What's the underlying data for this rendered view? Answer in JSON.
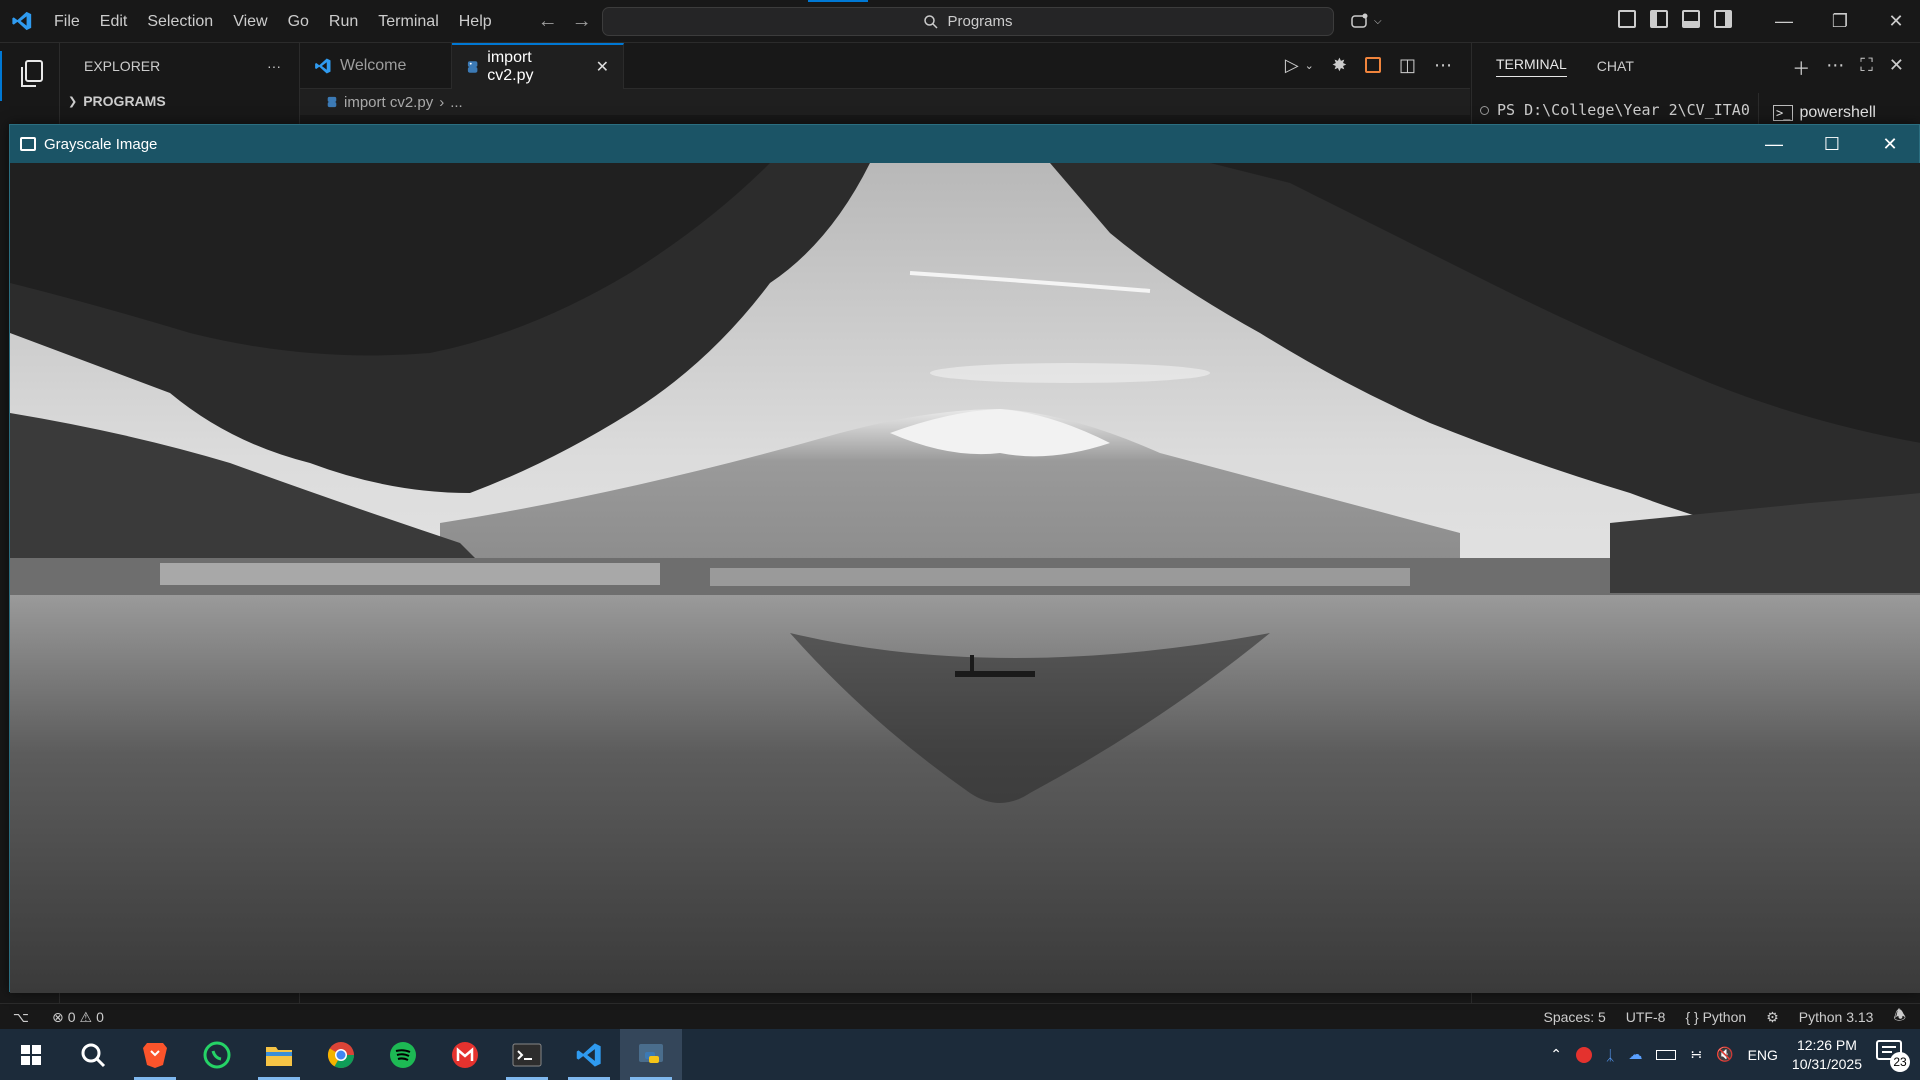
{
  "vscode": {
    "menu": [
      "File",
      "Edit",
      "Selection",
      "View",
      "Go",
      "Run",
      "Terminal",
      "Help"
    ],
    "command_center": "Programs",
    "explorer": {
      "title": "EXPLORER",
      "section": "PROGRAMS",
      "more": "···"
    },
    "tabs": [
      {
        "label": "Welcome",
        "icon": "vscode-icon"
      },
      {
        "label": "import cv2.py",
        "icon": "python-file-icon",
        "close": "✕"
      }
    ],
    "breadcrumb": {
      "file": "import cv2.py",
      "sep": "›",
      "rest": "..."
    },
    "panel": {
      "tabs": [
        "TERMINAL",
        "CHAT"
      ],
      "terminal_line": "PS D:\\College\\Year 2\\CV_ITA0",
      "terminal_name": "powershell"
    },
    "statusbar": {
      "errors": "0",
      "warnings": "0",
      "spaces": "Spaces: 5",
      "encoding": "UTF-8",
      "language": "Python",
      "interpreter": "Python 3.13"
    }
  },
  "cv_window": {
    "title": "Grayscale Image"
  },
  "taskbar": {
    "apps": [
      "start-button",
      "search",
      "brave",
      "whatsapp",
      "file-explorer",
      "chrome",
      "spotify",
      "gmail",
      "terminal",
      "vscode",
      "python"
    ],
    "tray": {
      "language": "ENG",
      "time": "12:26 PM",
      "date": "10/31/2025",
      "notifications": "23"
    }
  },
  "colors": {
    "accent": "#0078d4",
    "cv_title": "#1b5466",
    "taskbar": "#1c2b3a"
  }
}
